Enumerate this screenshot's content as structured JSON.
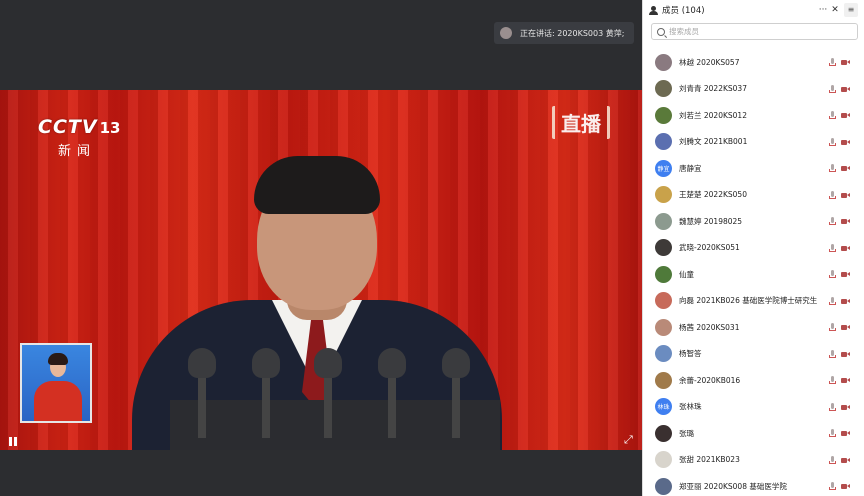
{
  "video": {
    "speaking_text": "正在讲话: 2020KS003 黄萍;",
    "logo_brand": "CCTV",
    "logo_channel": "13",
    "logo_sub": "新闻",
    "live_badge": "直播"
  },
  "panel": {
    "title": "成员 (104)",
    "more_label": "···",
    "close_label": "✕",
    "search_placeholder": "搜索成员",
    "members": [
      {
        "name": "林越 2020KS057",
        "avatar_text": "",
        "avatar_color": "#8a7a80"
      },
      {
        "name": "刘青青 2022KS037",
        "avatar_text": "",
        "avatar_color": "#6d6a52"
      },
      {
        "name": "刘若兰 2020KS012",
        "avatar_text": "",
        "avatar_color": "#5a7a3a"
      },
      {
        "name": "刘腾文 2021KB001",
        "avatar_text": "",
        "avatar_color": "#5b6fb0"
      },
      {
        "name": "唐静宜",
        "avatar_text": "静宜",
        "avatar_color": "#3f7ff0"
      },
      {
        "name": "王楚楚 2022KS050",
        "avatar_text": "",
        "avatar_color": "#c9a24a"
      },
      {
        "name": "魏慧婷 20198025",
        "avatar_text": "",
        "avatar_color": "#8c9a8f"
      },
      {
        "name": "武晓-2020KS051",
        "avatar_text": "",
        "avatar_color": "#3e3a38"
      },
      {
        "name": "仙童",
        "avatar_text": "",
        "avatar_color": "#4f7a3a"
      },
      {
        "name": "向磊 2021KB026 基础医学院博士研究生",
        "avatar_text": "",
        "avatar_color": "#c76a5a"
      },
      {
        "name": "杨茜 2020KS031",
        "avatar_text": "",
        "avatar_color": "#b98a78"
      },
      {
        "name": "杨智答",
        "avatar_text": "",
        "avatar_color": "#6b8cc0"
      },
      {
        "name": "余蕾-2020KB016",
        "avatar_text": "",
        "avatar_color": "#a07a4a"
      },
      {
        "name": "张林珠",
        "avatar_text": "林珠",
        "avatar_color": "#3f7ff0"
      },
      {
        "name": "张璐",
        "avatar_text": "",
        "avatar_color": "#3a3030"
      },
      {
        "name": "张甜 2021KB023",
        "avatar_text": "",
        "avatar_color": "#d8d4cc"
      },
      {
        "name": "郑亚丽 2020KS008 基础医学院",
        "avatar_text": "",
        "avatar_color": "#5a6a8a"
      }
    ]
  }
}
